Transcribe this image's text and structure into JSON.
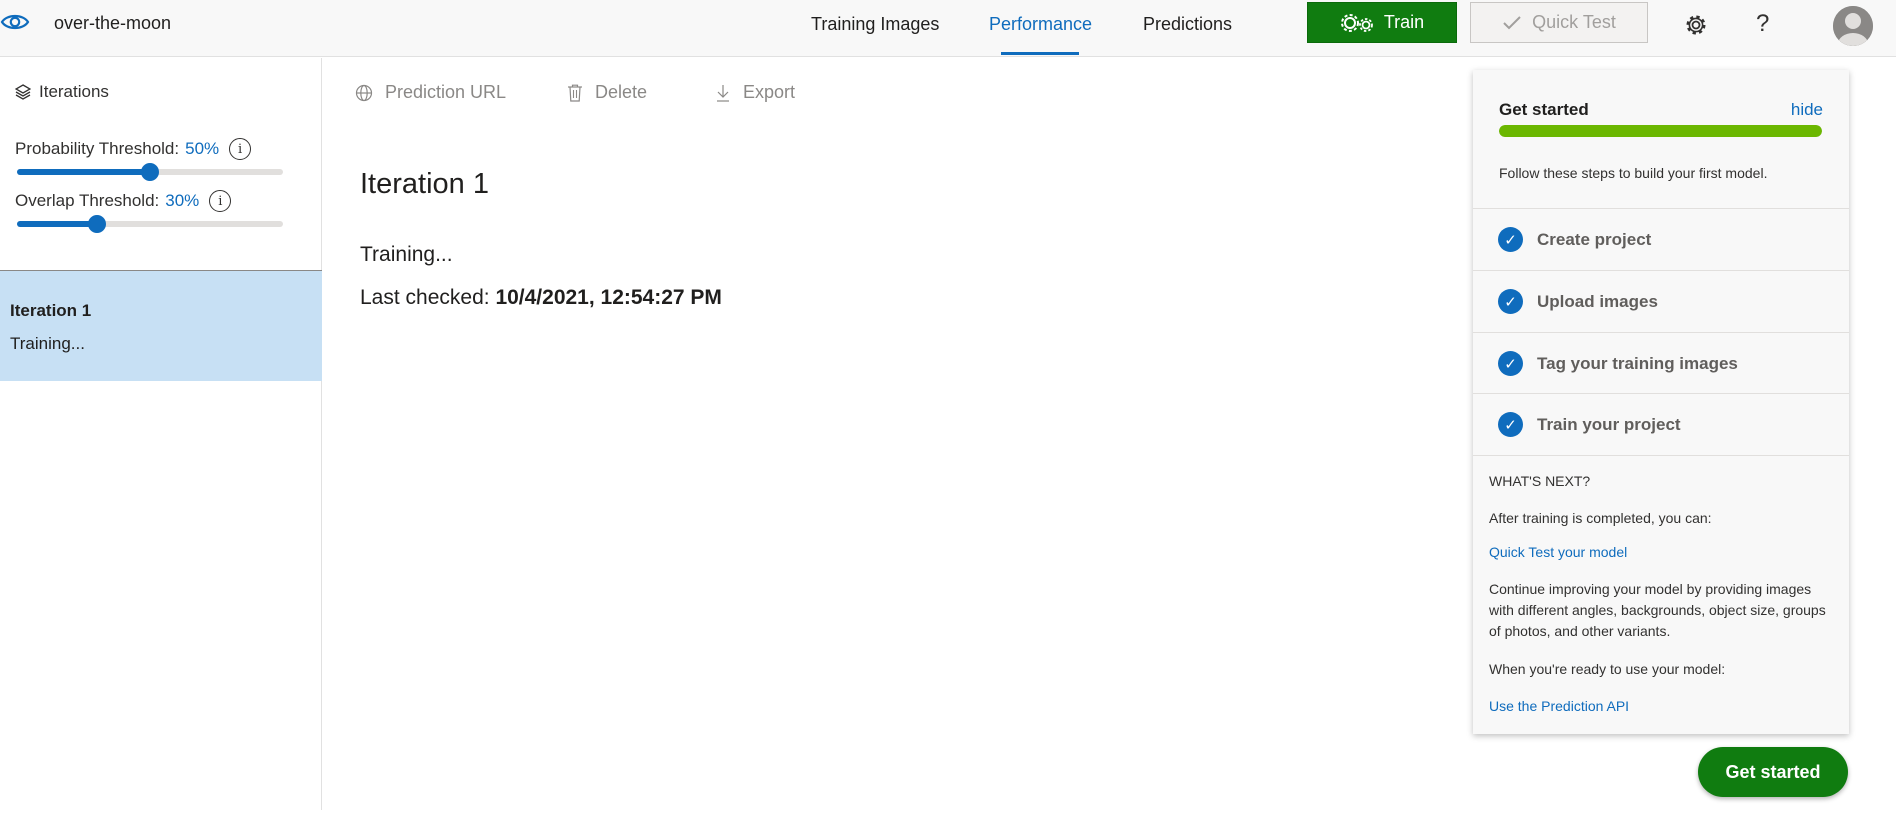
{
  "header": {
    "project_name": "over-the-moon",
    "tabs": [
      {
        "label": "Training Images"
      },
      {
        "label": "Performance"
      },
      {
        "label": "Predictions"
      }
    ],
    "train_label": "Train",
    "quick_test_label": "Quick Test",
    "help_label": "?"
  },
  "sidebar": {
    "iterations_label": "Iterations",
    "probability_threshold": {
      "label": "Probability Threshold:",
      "value": "50%",
      "fraction": 0.5
    },
    "overlap_threshold": {
      "label": "Overlap Threshold:",
      "value": "30%",
      "fraction": 0.3
    },
    "info_glyph": "i",
    "items": [
      {
        "name": "Iteration 1",
        "status": "Training..."
      }
    ]
  },
  "toolbar": {
    "prediction_url_label": "Prediction URL",
    "delete_label": "Delete",
    "export_label": "Export"
  },
  "main": {
    "title": "Iteration 1",
    "status": "Training...",
    "last_checked_label": "Last checked:",
    "last_checked_value": "10/4/2021, 12:54:27 PM"
  },
  "get_started": {
    "title": "Get started",
    "hide_label": "hide",
    "progress": 1.0,
    "description": "Follow these steps to build your first model.",
    "check_glyph": "✓",
    "steps": [
      {
        "label": "Create project"
      },
      {
        "label": "Upload images"
      },
      {
        "label": "Tag your training images"
      },
      {
        "label": "Train your project"
      }
    ],
    "whats_next_heading": "WHAT'S NEXT?",
    "after_training_text": "After training is completed, you can:",
    "quick_test_link": "Quick Test your model",
    "improve_text": "Continue improving your model by providing images with different angles, backgrounds, object size, groups of photos, and other variants.",
    "ready_text": "When you're ready to use your model:",
    "prediction_api_link": "Use the Prediction API",
    "button_label": "Get started"
  },
  "colors": {
    "accent": "#0f6cbd",
    "train_green": "#107c10",
    "progress_green": "#6bb700",
    "selected_row": "#c7e0f4"
  }
}
